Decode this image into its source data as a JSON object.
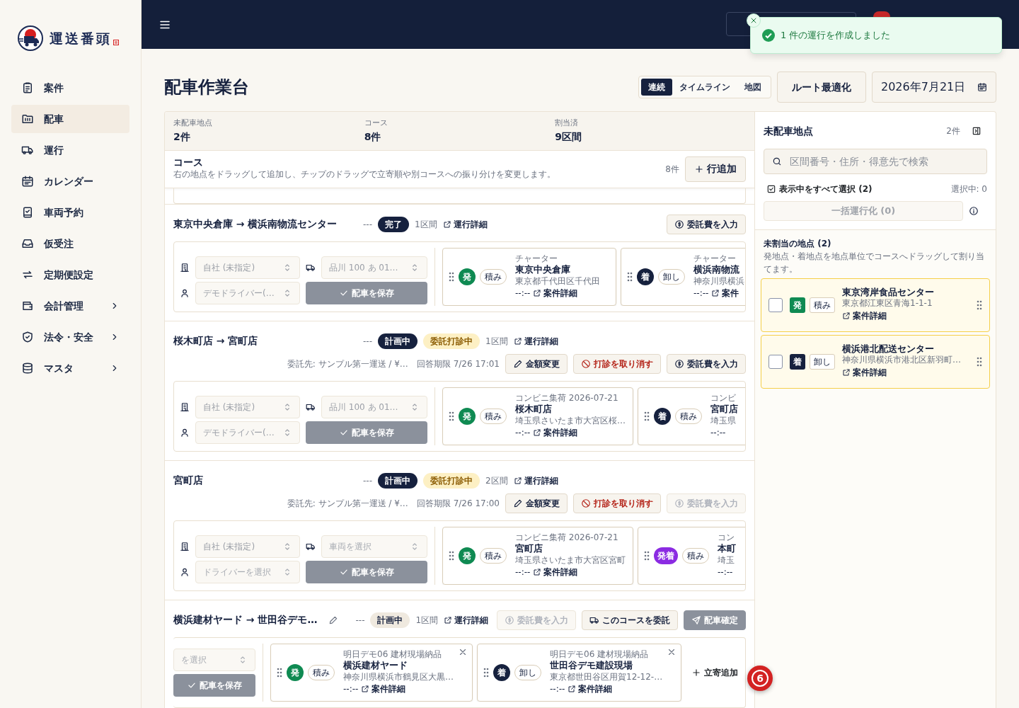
{
  "brand": {
    "name": "運送番頭"
  },
  "sidebar": {
    "items": [
      {
        "label": "案件",
        "selected": false,
        "expandable": false
      },
      {
        "label": "配車",
        "selected": true,
        "expandable": false
      },
      {
        "label": "運行",
        "selected": false,
        "expandable": false
      },
      {
        "label": "カレンダー",
        "selected": false,
        "expandable": false
      },
      {
        "label": "車両予約",
        "selected": false,
        "expandable": false
      },
      {
        "label": "仮受注",
        "selected": false,
        "expandable": false
      },
      {
        "label": "定期便設定",
        "selected": false,
        "expandable": false
      },
      {
        "label": "会計管理",
        "selected": false,
        "expandable": true
      },
      {
        "label": "法令・安全",
        "selected": false,
        "expandable": true
      },
      {
        "label": "マスタ",
        "selected": false,
        "expandable": true
      }
    ]
  },
  "toast": {
    "kind": "success",
    "message": "1 件の運行を作成しました"
  },
  "page": {
    "title": "配車作業台"
  },
  "view_tabs": [
    {
      "label": "連続",
      "selected": true
    },
    {
      "label": "タイムライン",
      "selected": false
    },
    {
      "label": "地図",
      "selected": false
    }
  ],
  "optimize_button": {
    "label": "ルート最適化"
  },
  "date_field": {
    "value": "2026年7月21日"
  },
  "stats": [
    {
      "label": "未配車地点",
      "value": "2件"
    },
    {
      "label": "コース",
      "value": "8件"
    },
    {
      "label": "割当済",
      "value": "9区間"
    }
  ],
  "courses_header": {
    "title": "コース",
    "description": "右の地点をドラッグして追加し、チップのドラッグで立寄順や別コースへの振り分けを変更します。",
    "count": "8件",
    "add_button": "行追加"
  },
  "courses": [
    {
      "title": "東京中央倉庫 → 横浜南物流センター",
      "editable": false,
      "dash": "---",
      "statuses": [
        {
          "label": "完了",
          "kind": "dark"
        }
      ],
      "sections": "1区間",
      "detail_link": "運行詳細",
      "actions": [
        {
          "kind": "fee",
          "label": "委託費を入力",
          "disabled": false
        }
      ],
      "company": {
        "value": "自社 (未指定)"
      },
      "vehicle": {
        "value": "品川 100 あ 01…"
      },
      "driver": {
        "value": "デモドライバー(…"
      },
      "save_button": "配車を保存",
      "stops": [
        {
          "kind": "origin",
          "kind_label": "発",
          "action": "積み",
          "category": "チャーター",
          "name": "東京中央倉庫",
          "address": "東京都千代田区千代田",
          "time": "--:--",
          "link": "案件詳細",
          "removable": false
        },
        {
          "kind": "destination",
          "kind_label": "着",
          "action": "卸し",
          "category": "チャーター",
          "name": "横浜南物流",
          "address": "神奈川県横浜",
          "time": "--:--",
          "link": "案件",
          "removable": false
        }
      ]
    },
    {
      "title": "桜木町店 → 宮町店",
      "editable": false,
      "dash": "---",
      "statuses": [
        {
          "label": "計画中",
          "kind": "dark"
        },
        {
          "label": "委託打診中",
          "kind": "pending"
        }
      ],
      "sections": "1区間",
      "detail_link": "運行詳細",
      "commission": {
        "text": "委託先: サンプル第一運送 / ¥…",
        "deadline": "回答期限 7/26 17:01"
      },
      "actions": [
        {
          "kind": "edit",
          "label": "金額変更",
          "disabled": false
        },
        {
          "kind": "cancel",
          "label": "打診を取り消す",
          "disabled": false
        },
        {
          "kind": "fee",
          "label": "委託費を入力",
          "disabled": false
        }
      ],
      "company": {
        "value": "自社 (未指定)"
      },
      "vehicle": {
        "value": "品川 100 あ 01…"
      },
      "driver": {
        "value": "デモドライバー(…"
      },
      "save_button": "配車を保存",
      "stops": [
        {
          "kind": "origin",
          "kind_label": "発",
          "action": "積み",
          "category": "コンビニ集荷 2026-07-21",
          "name": "桜木町店",
          "address": "埼玉県さいたま市大宮区桜…",
          "time": "--:--",
          "link": "案件詳細",
          "removable": false
        },
        {
          "kind": "destination",
          "kind_label": "着",
          "action": "積み",
          "category": "コンビ",
          "name": "宮町店",
          "address": "埼玉県",
          "time": "--:--",
          "removable": false
        }
      ]
    },
    {
      "title": "宮町店",
      "editable": false,
      "dash": "---",
      "statuses": [
        {
          "label": "計画中",
          "kind": "dark"
        },
        {
          "label": "委託打診中",
          "kind": "pending"
        }
      ],
      "sections": "2区間",
      "detail_link": "運行詳細",
      "commission": {
        "text": "委託先: サンプル第一運送 / ¥…",
        "deadline": "回答期限 7/26 17:00"
      },
      "actions": [
        {
          "kind": "edit",
          "label": "金額変更",
          "disabled": false
        },
        {
          "kind": "cancel",
          "label": "打診を取り消す",
          "disabled": false
        },
        {
          "kind": "fee",
          "label": "委託費を入力",
          "disabled": true
        }
      ],
      "company": {
        "value": "自社 (未指定)"
      },
      "vehicle": {
        "placeholder": "車両を選択"
      },
      "driver": {
        "placeholder": "ドライバーを選択"
      },
      "save_button": "配車を保存",
      "stops": [
        {
          "kind": "origin",
          "kind_label": "発",
          "action": "積み",
          "category": "コンビニ集荷 2026-07-21",
          "name": "宮町店",
          "address": "埼玉県さいたま市大宮区宮町",
          "time": "--:--",
          "link": "案件詳細",
          "removable": false
        },
        {
          "kind": "both",
          "kind_label": "発着",
          "action": "積み",
          "category": "コン",
          "name": "本町",
          "address": "埼玉",
          "time": "--:--",
          "removable": false
        }
      ]
    },
    {
      "title": "横浜建材ヤード → 世田谷デモ…",
      "editable": true,
      "dash": "---",
      "statuses": [
        {
          "label": "計画中",
          "kind": "light"
        }
      ],
      "sections": "1区間",
      "detail_link": "運行詳細",
      "actions": [
        {
          "kind": "fee",
          "label": "委託費を入力",
          "disabled": true
        },
        {
          "kind": "consign",
          "label": "このコースを委託",
          "disabled": false
        },
        {
          "kind": "confirm",
          "label": "配車確定",
          "disabled": false
        }
      ],
      "vehicle": {
        "placeholder": "を選択"
      },
      "save_button": "配車を保存",
      "stops": [
        {
          "kind": "origin",
          "kind_label": "発",
          "action": "積み",
          "category": "明日デモ06 建材現場納品",
          "name": "横浜建材ヤード",
          "address": "神奈川県横浜市鶴見区大黒…",
          "time": "--:--",
          "link": "案件詳細",
          "removable": true
        },
        {
          "kind": "destination",
          "kind_label": "着",
          "action": "卸し",
          "category": "明日デモ06 建材現場納品",
          "name": "世田谷デモ建設現場",
          "address": "東京都世田谷区用賀12-12-…",
          "time": "--:--",
          "link": "案件詳細",
          "removable": true
        }
      ],
      "add_stop": "立寄追加"
    }
  ],
  "unassigned_panel": {
    "title": "未配車地点",
    "count": "2件",
    "search": {
      "placeholder": "区間番号・住所・得意先で検索"
    },
    "select_all": "表示中をすべて選択 (2)",
    "selected_count": "選択中: 0",
    "bulk_button": {
      "label": "一括運行化 (0)",
      "disabled": true
    },
    "section": {
      "title": "未割当の地点 (2)",
      "description": "発地点・着地点を地点単位でコースへドラッグして割り当てます。"
    },
    "points": [
      {
        "checked": false,
        "kind": "origin",
        "kind_label": "発",
        "action": "積み",
        "name": "東京湾岸食品センター",
        "address": "東京都江東区青海1-1-1",
        "link": "案件詳細"
      },
      {
        "checked": false,
        "kind": "destination",
        "kind_label": "着",
        "action": "卸し",
        "name": "横浜港北配送センター",
        "address": "神奈川県横浜市港北区新羽町…",
        "link": "案件詳細"
      }
    ]
  },
  "dev_badge": {
    "label": "6"
  }
}
